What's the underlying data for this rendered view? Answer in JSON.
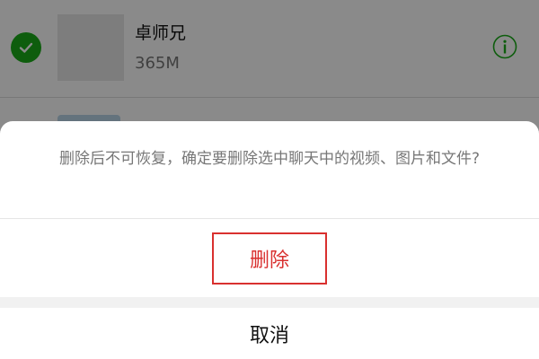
{
  "list": {
    "items": [
      {
        "name": "卓师兄",
        "size": "365M",
        "checked": true
      }
    ]
  },
  "sheet": {
    "message": "删除后不可恢复，确定要删除选中聊天中的视频、图片和文件?",
    "delete_label": "删除",
    "cancel_label": "取消"
  },
  "colors": {
    "accent_green": "#1aad19",
    "danger_red": "#d9302f"
  },
  "icons": [
    "check-icon",
    "info-icon"
  ]
}
